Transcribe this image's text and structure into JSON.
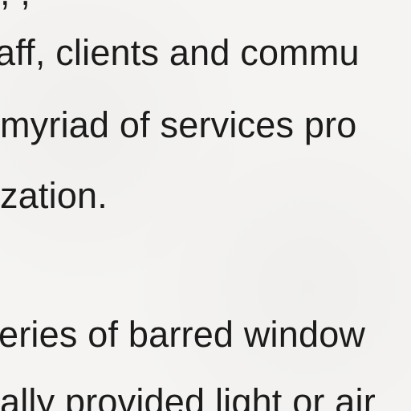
{
  "document": {
    "lines": [
      ", ,",
      "aff, clients and commu",
      " myriad of services pro",
      "zation.",
      "eries of barred window",
      "ally provided light or air"
    ]
  }
}
